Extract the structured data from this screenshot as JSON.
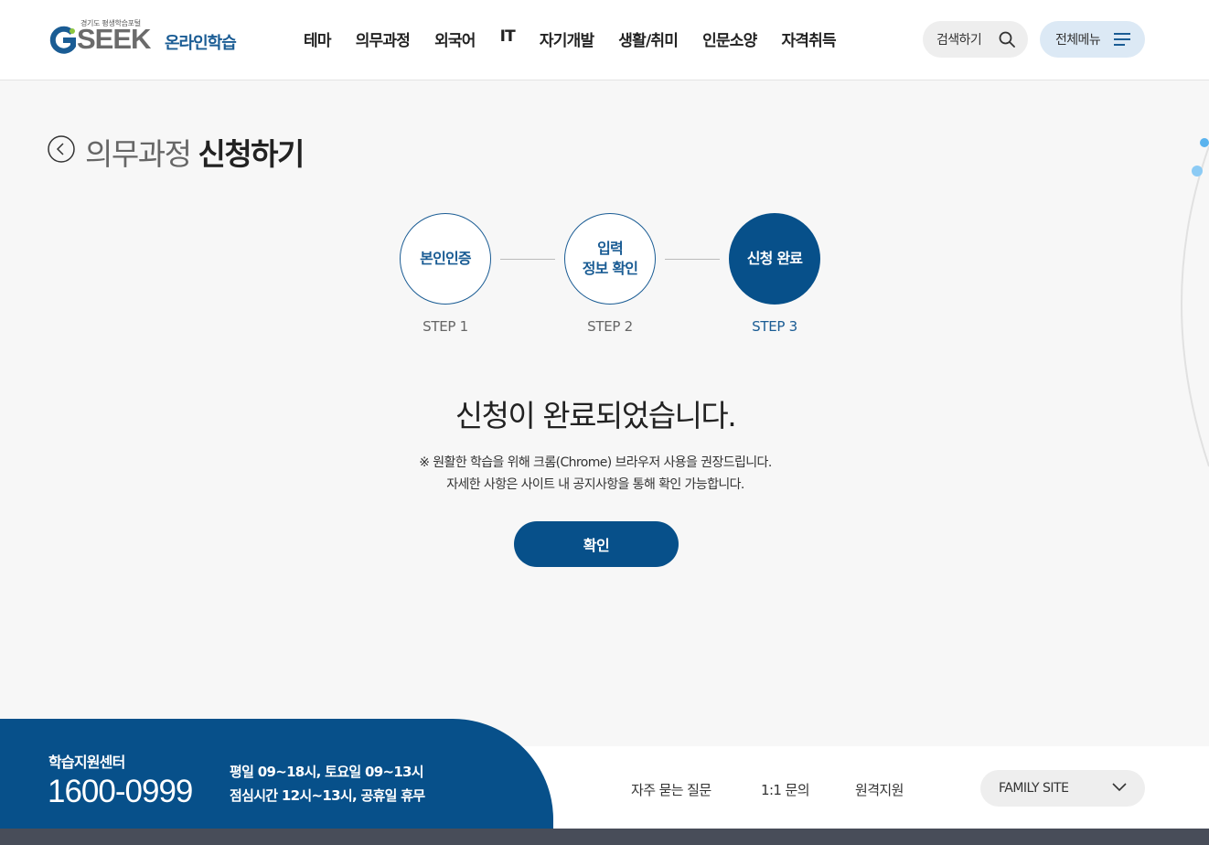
{
  "header": {
    "logo_sub": "경기도 평생학습포털",
    "logo_brand": "SEEK",
    "logo_online": "온라인학습",
    "nav": [
      "테마",
      "의무과정",
      "외국어",
      "IT",
      "자기개발",
      "생활/취미",
      "인문소양",
      "자격취득"
    ],
    "search_label": "검색하기",
    "menu_label": "전체메뉴"
  },
  "page": {
    "title_prefix": "의무과정",
    "title_main": "신청하기"
  },
  "steps": [
    {
      "text": "본인인증",
      "label": "STEP 1"
    },
    {
      "text": "입력\n정보 확인",
      "label": "STEP 2"
    },
    {
      "text": "신청 완료",
      "label": "STEP 3"
    }
  ],
  "result": {
    "title": "신청이 완료되었습니다.",
    "notice_1": "※ 원활한 학습을 위해 크롬(Chrome) 브라우저 사용을 권장드립니다.",
    "notice_2": "자세한 사항은 사이트 내 공지사항을 통해 확인 가능합니다.",
    "confirm_label": "확인"
  },
  "footer": {
    "support_label": "학습지원센터",
    "support_phone": "1600-0999",
    "hours_1": "평일 09~18시, 토요일 09~13시",
    "hours_2": "점심시간 12시~13시, 공휴일 휴무",
    "links": [
      "자주 묻는 질문",
      "1:1 문의",
      "원격지원"
    ],
    "family_site": "FAMILY SITE"
  },
  "colors": {
    "primary": "#07508a",
    "accent_light": "#dce9f5",
    "deco_dot": "#8ccbf5"
  }
}
